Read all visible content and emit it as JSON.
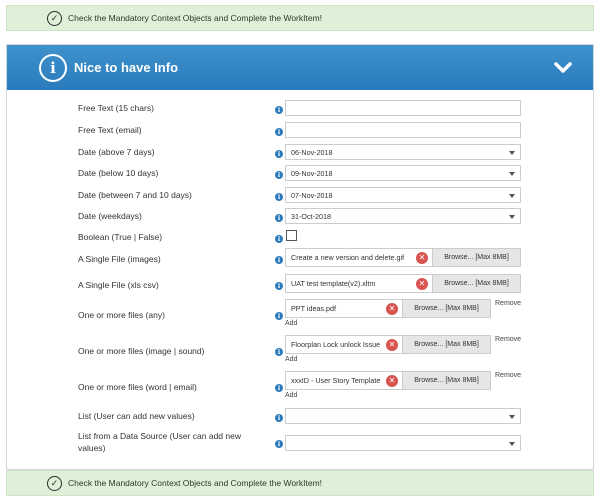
{
  "banner_top": {
    "text": "Check the Mandatory Context Objects and Complete the WorkItem!"
  },
  "banner_bottom": {
    "text": "Check the Mandatory Context Objects and Complete the WorkItem!"
  },
  "panel": {
    "title": "Nice to have Info"
  },
  "fields": {
    "free_text_15": {
      "label": "Free Text (15 chars)",
      "value": ""
    },
    "free_text_email": {
      "label": "Free Text (email)",
      "value": ""
    },
    "date_above_7": {
      "label": "Date (above 7 days)",
      "value": "06-Nov-2018"
    },
    "date_below_10": {
      "label": "Date (below 10 days)",
      "value": "09-Nov-2018"
    },
    "date_between": {
      "label": "Date (between 7 and 10 days)",
      "value": "07-Nov-2018"
    },
    "date_weekdays": {
      "label": "Date (weekdays)",
      "value": "31-Oct-2018"
    },
    "boolean": {
      "label": "Boolean (True | False)",
      "checked": false
    },
    "single_file_images": {
      "label": "A Single File (images)",
      "filename": "Create a new version and delete.gif",
      "browse": "Browse... [Max 8MB]"
    },
    "single_file_xls": {
      "label": "A Single File (xls csv)",
      "filename": "UAT test template(v2).xltm",
      "browse": "Browse... [Max 8MB]"
    },
    "files_any": {
      "label": "One or more files (any)",
      "filename": "PPT ideas.pdf",
      "browse": "Browse... [Max 8MB]",
      "remove": "Remove",
      "add": "Add"
    },
    "files_image_sound": {
      "label": "One or more files (image | sound)",
      "filename": "Floorplan Lock unlock Issue",
      "browse": "Browse... [Max 8MB]",
      "remove": "Remove",
      "add": "Add"
    },
    "files_word_email": {
      "label": "One or more files (word | email)",
      "filename": "xxxID - User Story Template",
      "browse": "Browse... [Max 8MB]",
      "remove": "Remove",
      "add": "Add"
    },
    "list_user": {
      "label": "List (User can add new values)",
      "value": ""
    },
    "list_datasource": {
      "label": "List from a Data Source (User can add new values)",
      "value": ""
    }
  },
  "icons": {
    "check": "check-circle-icon",
    "info": "info-circle-icon",
    "chevron": "chevron-down-icon",
    "remove": "remove-x-icon"
  },
  "colors": {
    "header_blue": "#2a7bbd",
    "banner_green": "#dff0d8",
    "remove_red": "#d9534f"
  }
}
